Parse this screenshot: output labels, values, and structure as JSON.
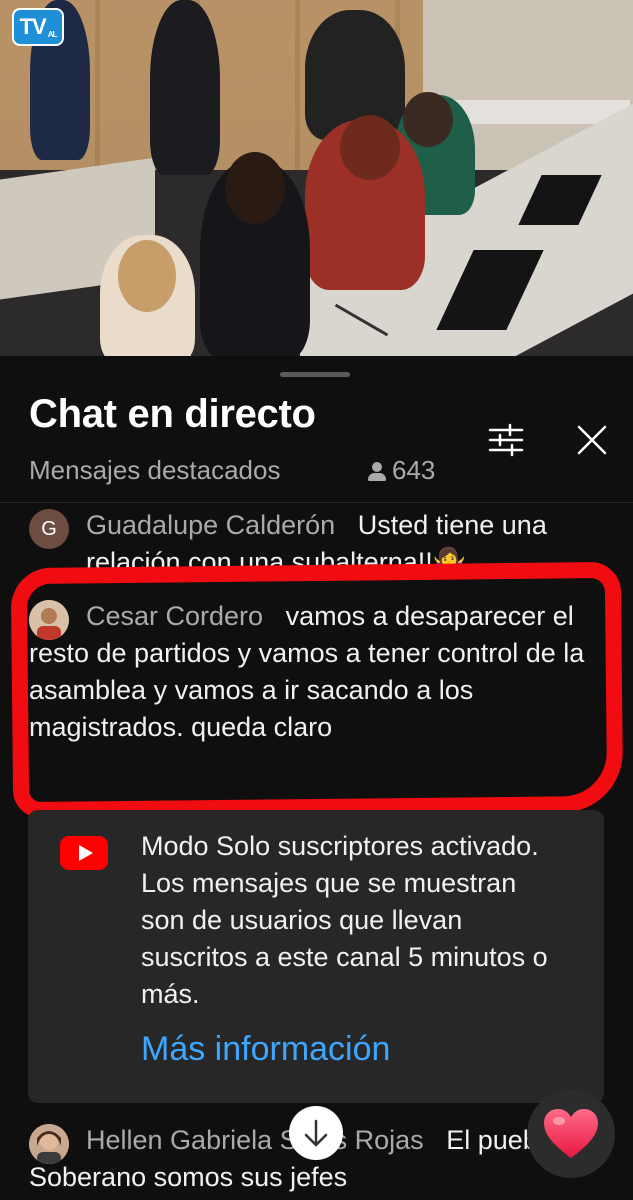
{
  "video": {
    "channel_logo_text": "TV",
    "channel_logo_sub": "AL"
  },
  "chat": {
    "title": "Chat en directo",
    "mode": "Mensajes destacados",
    "viewer_count": "643"
  },
  "messages": [
    {
      "author": "Guadalupe Calderón",
      "avatar_initial": "G",
      "text": "Usted tiene una relación con una subalterna!!🤷‍♀️"
    },
    {
      "author": "Cesar Cordero",
      "text": "vamos a desaparecer el resto de partidos y vamos a tener control de la asamblea y vamos a ir sacando a los magistrados. queda claro"
    },
    {
      "author": "Hellen Gabriela Salas Rojas",
      "text": "El pueblo Soberano somos sus jefes"
    }
  ],
  "notice": {
    "text": "Modo Solo suscriptores activado. Los mensajes que se muestran son de usuarios que llevan suscritos a este canal 5 minutos o más.",
    "link": "Más información"
  },
  "colors": {
    "background": "#0f0f0f",
    "card": "#272727",
    "link": "#3ea6ff",
    "highlight_outline": "#f10c12",
    "youtube_red": "#ff0000"
  },
  "icons": [
    "filter-icon",
    "close-icon",
    "person-icon",
    "youtube-icon",
    "arrow-down-icon",
    "heart-icon"
  ]
}
